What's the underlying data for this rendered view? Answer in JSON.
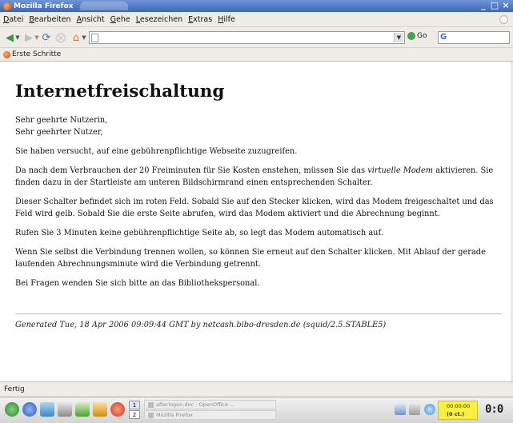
{
  "window": {
    "title": "Mozilla Firefox",
    "controls": [
      "_",
      "□",
      "×"
    ]
  },
  "menu": [
    "Datei",
    "Bearbeiten",
    "Ansicht",
    "Gehe",
    "Lesezeichen",
    "Extras",
    "Hilfe"
  ],
  "navigation": {
    "url": "",
    "go_label": "Go",
    "search_value": ""
  },
  "bookmarks": [
    {
      "label": "Erste Schritte",
      "icon": "firefox-icon"
    }
  ],
  "page": {
    "heading": "Internetfreischaltung",
    "greeting_line1": "Sehr geehrte Nutzerin,",
    "greeting_line2": "Sehr geehrter Nutzer,",
    "p1": "Sie haben versucht, auf eine gebührenpflichtige Webseite zuzugreifen.",
    "p2_before": "Da nach dem Verbrauchen der 20 Freiminuten für Sie Kosten enstehen, müssen Sie das ",
    "p2_em": "virtuelle Modem",
    "p2_after": " aktivieren. Sie finden dazu in der Startleiste am unteren Bildschirmrand einen entsprechenden Schalter.",
    "p3": "Dieser Schalter befindet sich im roten Feld. Sobald Sie auf den Stecker klicken, wird das Modem freigeschaltet und das Feld wird gelb. Sobald Sie die erste Seite abrufen, wird das Modem aktiviert und die Abrechnung beginnt.",
    "p4": "Rufen Sie 3 Minuten keine gebührenpflichtige Seite ab, so legt das Modem automatisch auf.",
    "p5": "Wenn Sie selbst die Verbindung trennen wollen, so können Sie erneut auf den Schalter klicken. Mit Ablauf der gerade laufenden Abrechnungsminute wird die Verbindung getrennt.",
    "p6": "Bei Fragen wenden Sie sich bitte an das Bibliothekspersonal.",
    "footer": "Generated Tue, 18 Apr 2006 09:09:44 GMT by netcash.bibo-dresden.de (squid/2.5.STABLE5)"
  },
  "status": "Fertig",
  "taskbar": {
    "pages": [
      "1",
      "2"
    ],
    "tasks": [
      "afterlogon.doc - OpenOffice ...",
      "Mozilla Firefox"
    ],
    "modem_time": "00:00:00",
    "modem_cost": "(0 ct.)",
    "clock": "0:0"
  },
  "colors": {
    "titlebar": "#3e66b8",
    "chrome": "#efebe7",
    "modem_active": "#f8f040"
  }
}
